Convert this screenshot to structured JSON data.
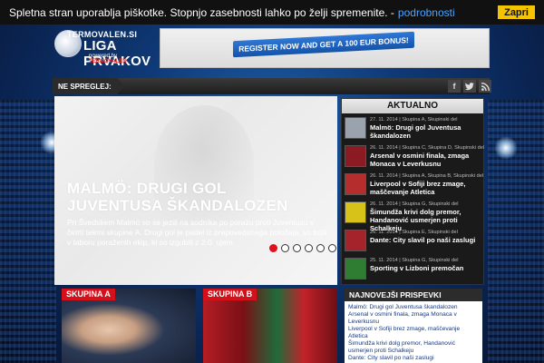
{
  "cookie": {
    "text": "Spletna stran uporablja piškotke. Stopnjo zasebnosti lahko po želji spremenite. - ",
    "link": "podrobnosti",
    "button": "Zapri"
  },
  "logo": {
    "site": "TERMOVALEN.SI",
    "title": "LIGA PRVAKOV",
    "powered": "powered by",
    "powered_brand": "TERMOVALEN"
  },
  "banner": {
    "text": "REGISTER NOW AND GET A 100 EUR BONUS!"
  },
  "strip": {
    "label": "NE SPREGLEJ:",
    "social": [
      "f",
      "t",
      "rss"
    ]
  },
  "slider": {
    "title": "MALMÖ: DRUGI GOL JUVENTUSA ŠKANDALOZEN",
    "desc": "Pri Švedskem Malmö so se jezili na sodnika po porazu proti Juventusu v četrti tekmi skupine A. Drugi gol je padel iz prepovedanega položaja, so trdili v taboru poraženih ekip, ki so izgubili z 2:0. ujem",
    "active_index": 0,
    "count": 6
  },
  "aktualno": {
    "heading": "AKTUALNO",
    "items": [
      {
        "meta": "27. 11. 2014 | Skupina A, Skupinski del",
        "title": "Malmö: Drugi gol Juventusa škandalozen",
        "thumb": "#9aa3ad"
      },
      {
        "meta": "26. 11. 2014 | Skupina C, Skupina D, Skupinski del",
        "title": "Arsenal v osmini finala, zmaga Monaca v Leverkusnu",
        "thumb": "#8b1a22"
      },
      {
        "meta": "26. 11. 2014 | Skupina A, Skupina B, Skupinski del",
        "title": "Liverpool v Sofiji brez zmage, maščevanje Atletica",
        "thumb": "#b52d2d"
      },
      {
        "meta": "26. 11. 2014 | Skupina G, Skupinski del",
        "title": "Šimundža krivi dolg premor, Handanović usmerjen proti Schalkeju",
        "thumb": "#d7c21a"
      },
      {
        "meta": "26. 11. 2014 | Skupina E, Skupinski del",
        "title": "Dante: City slavil po naši zaslugi",
        "thumb": "#a5232a"
      },
      {
        "meta": "25. 11. 2014 | Skupina G, Skupinski del",
        "title": "Sporting v Lizboni premočan",
        "thumb": "#2e7d32"
      }
    ]
  },
  "cards": [
    {
      "label": "SKUPINA A"
    },
    {
      "label": "SKUPINA B"
    }
  ],
  "najnovejsi": {
    "heading": "NAJNOVEJŠI PRISPEVKI",
    "items": [
      "Malmö: Drugi gol Juventusa škandalozen",
      "Arsenal v osmini finala, zmaga Monaca v Leverkusnu",
      "Liverpool v Sofiji brez zmage, maščevanje Atletica",
      "Šimundža krivi dolg premor, Handanović usmerjen proti Schalkeju",
      "Dante: City slavil po naši zaslugi"
    ]
  }
}
